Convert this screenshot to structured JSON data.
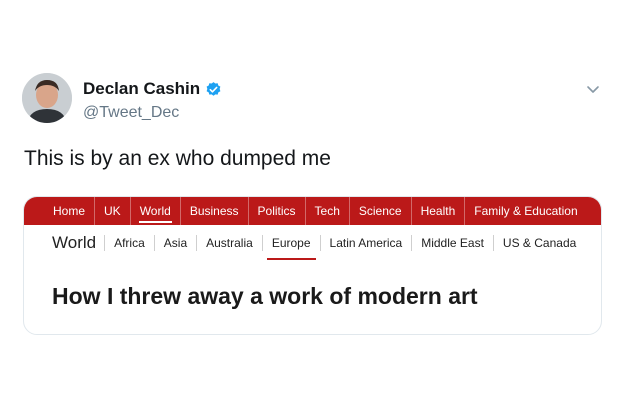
{
  "tweet": {
    "display_name": "Declan Cashin",
    "handle": "@Tweet_Dec",
    "verified": true,
    "text": "This is by an ex who dumped me",
    "accent_color": "#1da1f2"
  },
  "card": {
    "top_nav": {
      "items": [
        {
          "label": "Home"
        },
        {
          "label": "UK"
        },
        {
          "label": "World",
          "active": true
        },
        {
          "label": "Business"
        },
        {
          "label": "Politics"
        },
        {
          "label": "Tech"
        },
        {
          "label": "Science"
        },
        {
          "label": "Health"
        },
        {
          "label": "Family & Education"
        }
      ],
      "background_color": "#bb1919"
    },
    "section_title": "World",
    "sub_nav": {
      "items": [
        {
          "label": "Africa"
        },
        {
          "label": "Asia"
        },
        {
          "label": "Australia"
        },
        {
          "label": "Europe",
          "active": true
        },
        {
          "label": "Latin America"
        },
        {
          "label": "Middle East"
        },
        {
          "label": "US & Canada"
        }
      ]
    },
    "headline": "How I threw away a work of modern art"
  }
}
